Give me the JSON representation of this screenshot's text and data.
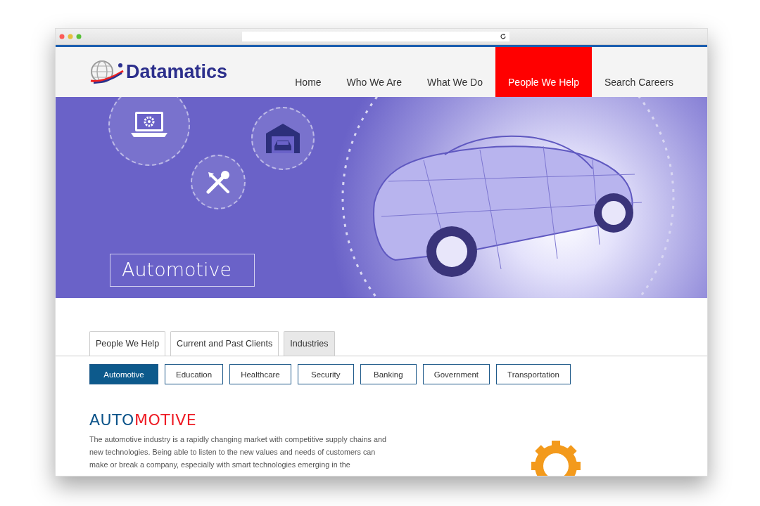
{
  "logo": {
    "text": "Datamatics"
  },
  "nav": [
    {
      "label": "Home",
      "selected": false
    },
    {
      "label": "Who We Are",
      "selected": false
    },
    {
      "label": "What We Do",
      "selected": false
    },
    {
      "label": "People We Help",
      "selected": true
    },
    {
      "label": "Search Careers",
      "selected": false
    }
  ],
  "hero": {
    "title": "Automotive"
  },
  "tabs": [
    {
      "label": "People We Help",
      "selected": false
    },
    {
      "label": "Current and Past Clients",
      "selected": false
    },
    {
      "label": "Industries",
      "selected": true
    }
  ],
  "filters": [
    {
      "label": "Automotive",
      "selected": true
    },
    {
      "label": "Education",
      "selected": false
    },
    {
      "label": "Healthcare",
      "selected": false
    },
    {
      "label": "Security",
      "selected": false
    },
    {
      "label": "Banking",
      "selected": false
    },
    {
      "label": "Government",
      "selected": false
    },
    {
      "label": "Transportation",
      "selected": false
    }
  ],
  "heading": {
    "parts": [
      {
        "text": "AUTO",
        "color": "#0b5389"
      },
      {
        "text": "MOTIVE",
        "color": "#ee1c25"
      }
    ]
  },
  "paragraph": "The automotive industry is a rapidly changing market with competitive supply chains and new technologies. Being able to listen to the new values and needs of customers can make or break a company, especially with smart technologies emerging in the"
}
